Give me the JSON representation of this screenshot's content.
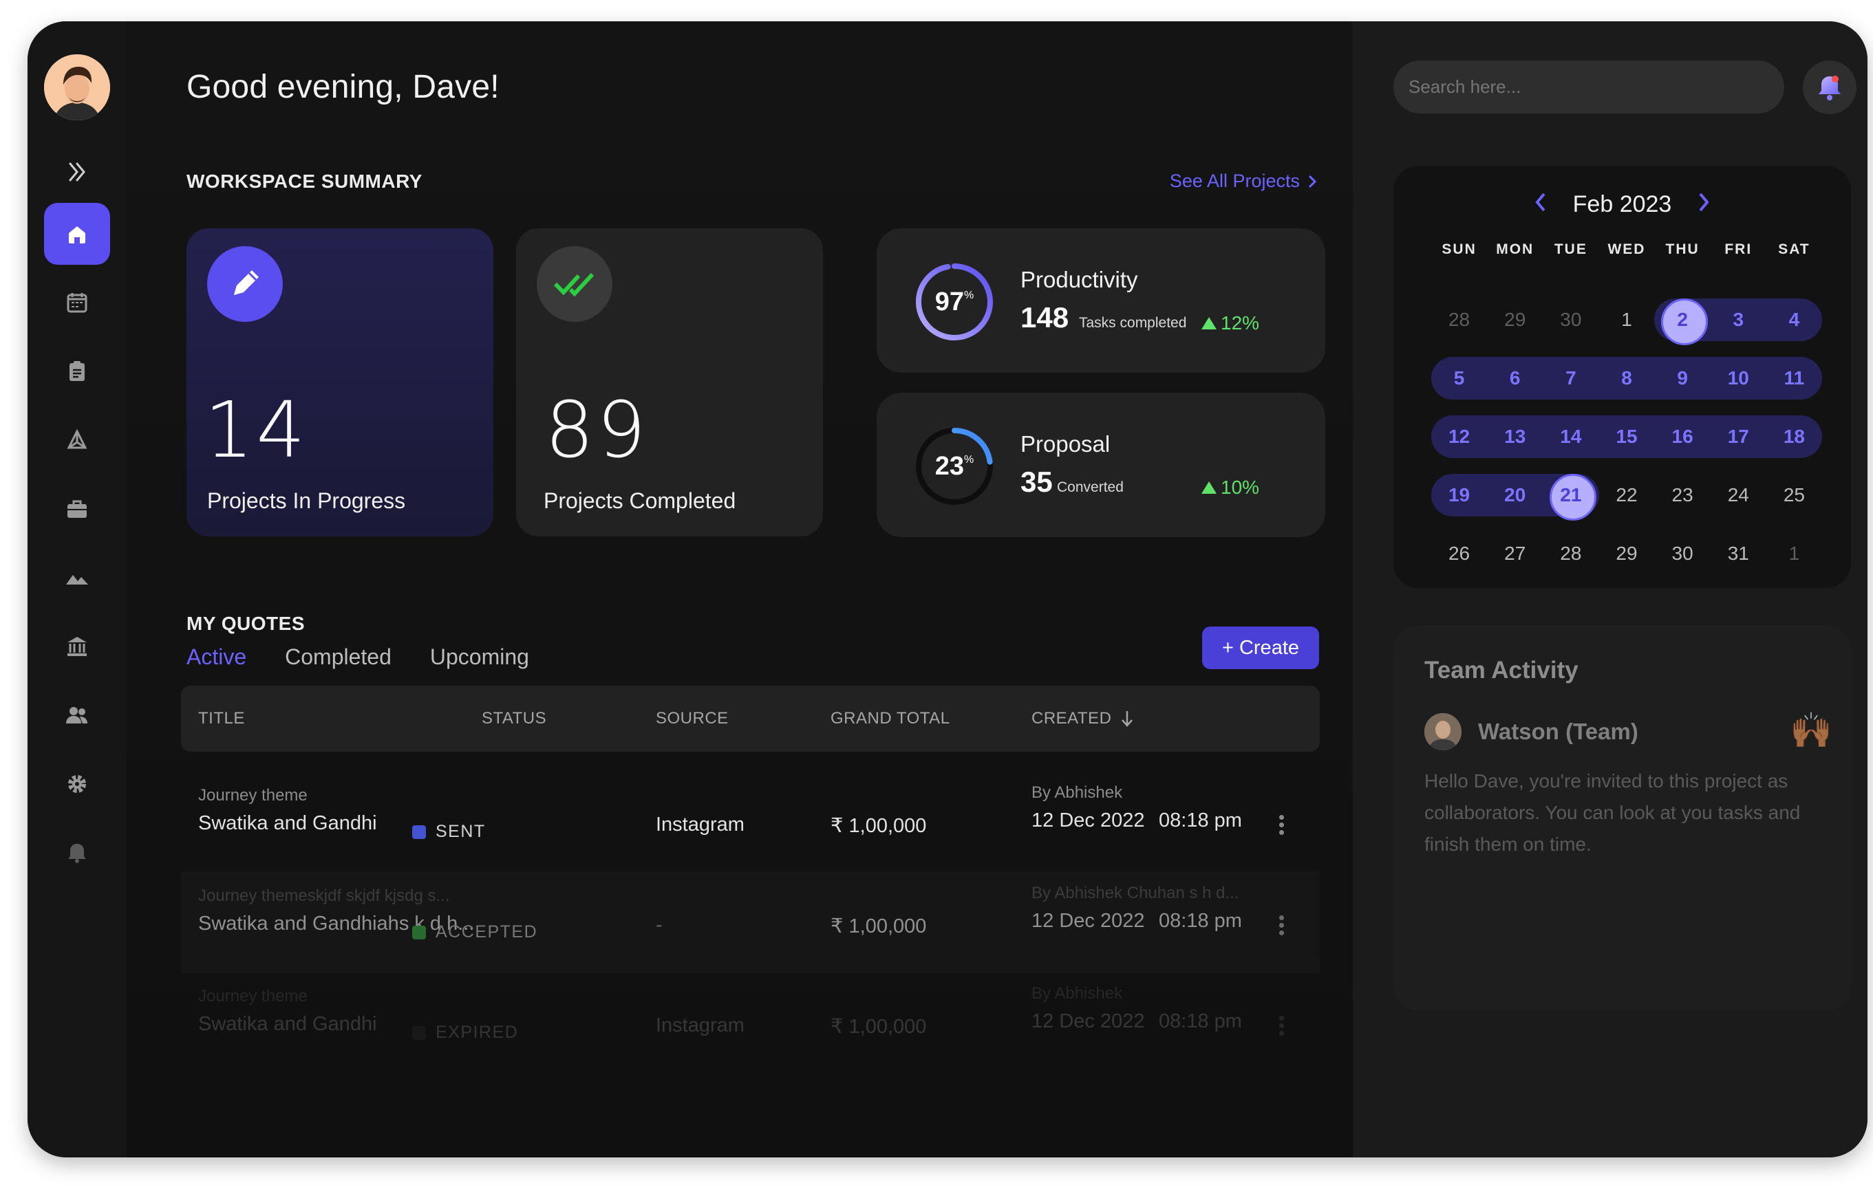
{
  "greeting": "Good evening, Dave!",
  "workspace": {
    "title": "WORKSPACE SUMMARY",
    "see_all": "See All Projects",
    "in_progress": {
      "value": "14",
      "label": "Projects In Progress"
    },
    "completed": {
      "value": "89",
      "label": "Projects Completed"
    },
    "productivity": {
      "percent": "97",
      "percent_sign": "%",
      "progress": 0.97,
      "title": "Productivity",
      "value": "148",
      "sub": "Tasks completed",
      "change": "12%"
    },
    "proposal": {
      "percent": "23",
      "percent_sign": "%",
      "progress": 0.23,
      "title": "Proposal",
      "value": "35",
      "sub": "Converted",
      "change": "10%"
    }
  },
  "quotes": {
    "title": "MY QUOTES",
    "tabs": [
      "Active",
      "Completed",
      "Upcoming"
    ],
    "create_label": "+ Create",
    "columns": [
      "TITLE",
      "STATUS",
      "SOURCE",
      "GRAND TOTAL",
      "CREATED"
    ],
    "rows": [
      {
        "theme": "Journey theme",
        "title": "Swatika and Gandhi",
        "status": "SENT",
        "status_color": "#4353d1",
        "source": "Instagram",
        "total": "₹ 1,00,000",
        "by": "By Abhishek",
        "date": "12 Dec 2022",
        "time": "08:18 pm"
      },
      {
        "theme": "Journey themeskjdf skjdf kjsdg s...",
        "title": "Swatika and Gandhiahs k d h...",
        "status": "ACCEPTED",
        "status_color": "#2f8a3a",
        "source": "-",
        "total": "₹ 1,00,000",
        "by": "By Abhishek Chuhan s h d...",
        "date": "12 Dec 2022",
        "time": "08:18 pm"
      },
      {
        "theme": "Journey theme",
        "title": "Swatika and Gandhi",
        "status": "EXPIRED",
        "status_color": "#3a3a3a",
        "source": "Instagram",
        "total": "₹ 1,00,000",
        "by": "By Abhishek",
        "date": "12 Dec 2022",
        "time": "08:18 pm"
      }
    ]
  },
  "search": {
    "placeholder": "Search here..."
  },
  "calendar": {
    "month": "Feb 2023",
    "weekdays": [
      "SUN",
      "MON",
      "TUE",
      "WED",
      "THU",
      "FRI",
      "SAT"
    ],
    "weeks": [
      [
        "28",
        "29",
        "30",
        "1",
        "2",
        "3",
        "4"
      ],
      [
        "5",
        "6",
        "7",
        "8",
        "9",
        "10",
        "11"
      ],
      [
        "12",
        "13",
        "14",
        "15",
        "16",
        "17",
        "18"
      ],
      [
        "19",
        "20",
        "21",
        "22",
        "23",
        "24",
        "25"
      ],
      [
        "26",
        "27",
        "28",
        "29",
        "30",
        "31",
        "1"
      ]
    ],
    "range_start": "2",
    "range_end": "21"
  },
  "team_activity": {
    "title": "Team Activity",
    "name": "Watson (Team)",
    "emoji": "🙌🏾",
    "message": "Hello Dave, you're invited to this project as collaborators. You can look at you tasks and finish them on time."
  },
  "colors": {
    "accent": "#6c63ff",
    "accent_btn": "#4a3fd6",
    "positive": "#5fe26a"
  }
}
